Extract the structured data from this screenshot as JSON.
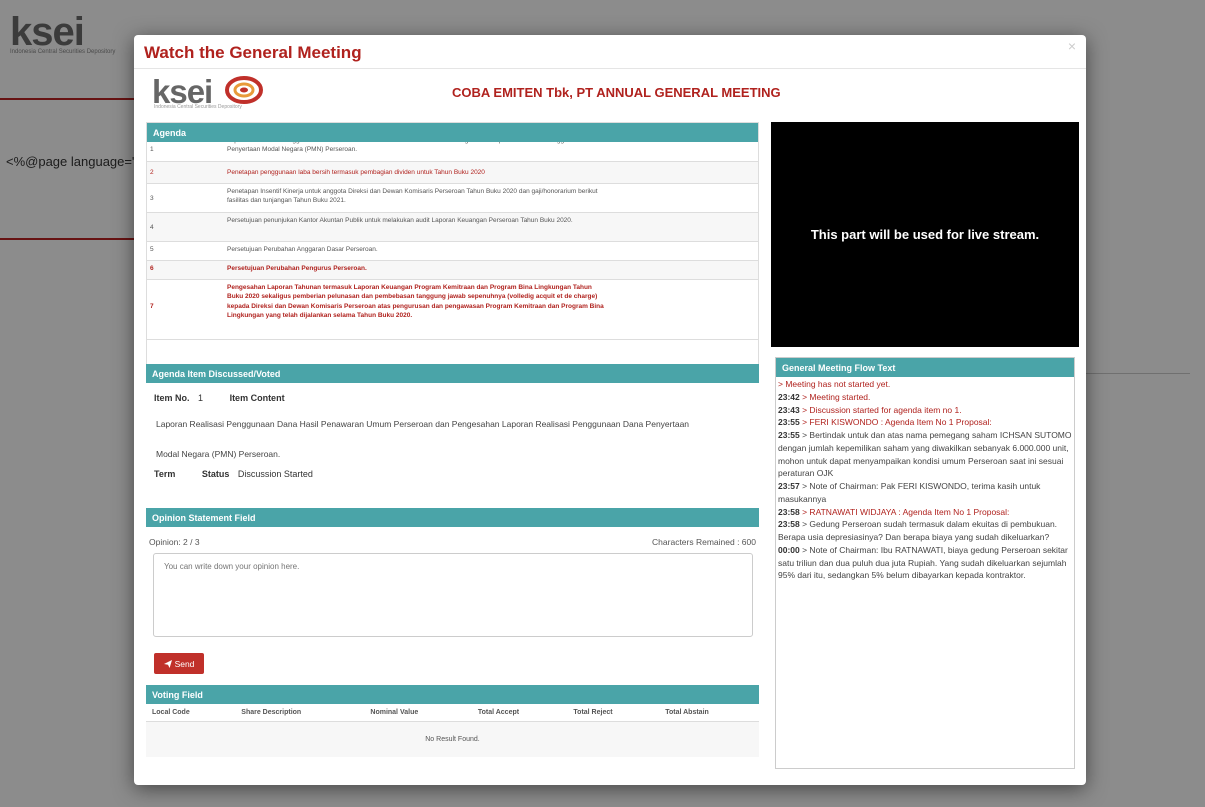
{
  "background": {
    "logo": "ksei",
    "logo_sub": "Indonesia Central Securities Depository",
    "code_text": "<%@page language=\"ja"
  },
  "modal": {
    "title": "Watch the General Meeting",
    "close_label": "×",
    "brand": "ksei",
    "brand_sub": "Indonesia Central Securities Depository",
    "meeting_title": "COBA EMITEN Tbk, PT ANNUAL GENERAL MEETING"
  },
  "agenda": {
    "heading": "Agenda",
    "items": [
      {
        "num": "1",
        "text": "Laporan Realisasi Penggunaan Dana Hasil Penawaran Umum Perseroan dan Pengesahan Laporan Realisasi Penggunaan Dana Penyertaan Modal Negara (PMN) Perseroan."
      },
      {
        "num": "2",
        "text": "Penetapan penggunaan laba bersih termasuk pembagian dividen untuk Tahun Buku 2020"
      },
      {
        "num": "3",
        "text": "Penetapan Insentif Kinerja untuk anggota Direksi dan Dewan Komisaris Perseroan Tahun Buku 2020 dan gaji/honorarium berikut fasilitas dan tunjangan Tahun Buku 2021."
      },
      {
        "num": "4",
        "text": "Persetujuan penunjukan Kantor Akuntan Publik untuk melakukan audit Laporan Keuangan Perseroan Tahun Buku 2020."
      },
      {
        "num": "5",
        "text": "Persetujuan Perubahan Anggaran Dasar Perseroan."
      },
      {
        "num": "6",
        "text": "Persetujuan Perubahan Pengurus Perseroan."
      },
      {
        "num": "7",
        "text": "Pengesahan Laporan Tahunan termasuk Laporan Keuangan Program Kemitraan dan Program Bina Lingkungan Tahun Buku 2020 sekaligus pemberian pelunasan dan pembebasan tanggung jawab sepenuhnya (volledig acquit et de charge) kepada Direksi dan Dewan Komisaris Perseroan atas pengurusan dan pengawasan Program Kemitraan dan Program Bina Lingkungan yang telah dijalankan selama Tahun Buku 2020."
      }
    ]
  },
  "discussed": {
    "heading": "Agenda Item Discussed/Voted",
    "item_no_label": "Item No.",
    "item_no_value": "1",
    "item_content_label": "Item Content",
    "content_line1": "Laporan Realisasi Penggunaan Dana Hasil Penawaran Umum Perseroan dan Pengesahan Laporan Realisasi Penggunaan Dana Penyertaan",
    "content_line2": "Modal Negara (PMN) Perseroan.",
    "term_label": "Term",
    "status_label": "Status",
    "status_value": "Discussion Started"
  },
  "opinion": {
    "heading": "Opinion Statement Field",
    "count": "Opinion: 2 / 3",
    "chars_remaining": "Characters Remained : 600",
    "placeholder": "You can write down your opinion here.",
    "send_label": "Send"
  },
  "voting": {
    "heading": "Voting Field",
    "columns": [
      "Local Code",
      "Share Description",
      "Nominal Value",
      "Total Accept",
      "Total Reject",
      "Total Abstain"
    ],
    "empty_text": "No Result Found."
  },
  "stream": {
    "text": "This part will be used for live stream."
  },
  "flow": {
    "heading": "General Meeting Flow Text",
    "entries": [
      {
        "time": "",
        "text": "> Meeting has not started yet.",
        "red": true
      },
      {
        "time": "23:42",
        "text": " > Meeting started.",
        "red": true
      },
      {
        "time": "23:43",
        "text": " > Discussion started for agenda item no 1.",
        "red": true
      },
      {
        "time": "23:55",
        "text": " > FERI KISWONDO : Agenda Item No 1 Proposal:",
        "red": true
      },
      {
        "time": "23:55",
        "text": " > Bertindak untuk dan atas nama pemegang saham ICHSAN SUTOMO dengan jumlah kepemilikan saham yang diwakilkan sebanyak 6.000.000 unit, mohon untuk dapat menyampaikan kondisi umum Perseroan saat ini sesuai peraturan OJK",
        "red": false
      },
      {
        "time": "23:57",
        "text": " > Note of Chairman: Pak FERI KISWONDO, terima kasih untuk masukannya",
        "red": false
      },
      {
        "time": "23:58",
        "text": " > RATNAWATI WIDJAYA : Agenda Item No 1 Proposal:",
        "red": true
      },
      {
        "time": "23:58",
        "text": " > Gedung Perseroan sudah termasuk dalam ekuitas di pembukuan. Berapa usia depresiasinya? Dan berapa biaya yang sudah dikeluarkan?",
        "red": false
      },
      {
        "time": "00:00",
        "text": " > Note of Chairman: Ibu RATNAWATI, biaya gedung Perseroan sekitar satu triliun dan dua puluh dua juta Rupiah. Yang sudah dikeluarkan sejumlah 95% dari itu, sedangkan 5% belum dibayarkan kepada kontraktor.",
        "red": false
      }
    ]
  }
}
